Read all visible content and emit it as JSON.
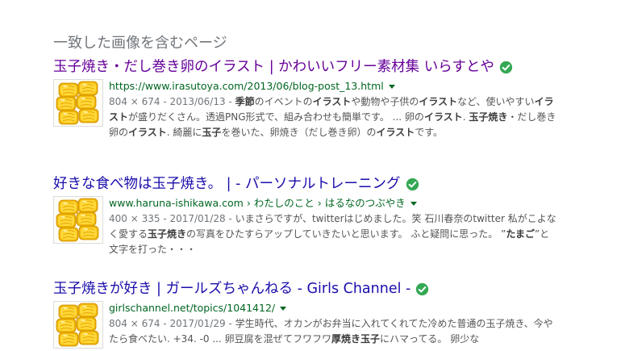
{
  "section_heading": "一致した画像を含むページ",
  "results": [
    {
      "title": "玉子焼き・だし巻き卵のイラスト | かわいいフリー素材集 いらすとや",
      "url": "https://www.irasutoya.com/2013/06/blog-post_13.html",
      "info": "804 × 674 - 2013/06/13 - ",
      "snippet": [
        {
          "t": "季節",
          "b": true
        },
        {
          "t": "のイベントの",
          "b": false
        },
        {
          "t": "イラスト",
          "b": true
        },
        {
          "t": "や動物や子供の",
          "b": false
        },
        {
          "t": "イラスト",
          "b": true
        },
        {
          "t": "など、使いやすい",
          "b": false
        },
        {
          "t": "イラスト",
          "b": true
        },
        {
          "t": "が盛りだくさん。透過PNG形式で、組み合わせも簡単です。 ... 卵の",
          "b": false
        },
        {
          "t": "イラスト",
          "b": true
        },
        {
          "t": ". ",
          "b": false
        },
        {
          "t": "玉子焼き",
          "b": true
        },
        {
          "t": "・だし巻き卵の",
          "b": false
        },
        {
          "t": "イラスト",
          "b": true
        },
        {
          "t": ". 綺麗に",
          "b": false
        },
        {
          "t": "玉子",
          "b": true
        },
        {
          "t": "を巻いた、卵焼き（だし巻き卵）の",
          "b": false
        },
        {
          "t": "イラスト",
          "b": true
        },
        {
          "t": "です。",
          "b": false
        }
      ],
      "visited": true
    },
    {
      "title": "好きな食べ物は玉子焼き。 | - パーソナルトレーニング",
      "url": "www.haruna-ishikawa.com › わたしのこと › はるなのつぶやき",
      "info": "400 × 335 - 2017/01/28 - ",
      "snippet": [
        {
          "t": "いまさらですが、twitterはじめました。笑 石川春奈のtwitter 私がこよなく愛する",
          "b": false
        },
        {
          "t": "玉子焼き",
          "b": true
        },
        {
          "t": "の写真をひたすらアップしていきたいと思います。 ふと疑問に思った。 ”",
          "b": false
        },
        {
          "t": "たまご",
          "b": true
        },
        {
          "t": "”と文字を打った・・・",
          "b": false
        }
      ],
      "visited": false
    },
    {
      "title": "玉子焼きが好き | ガールズちゃんねる - Girls Channel -",
      "url": "girlschannel.net/topics/1041412/",
      "info": "804 × 674 - 2017/01/29 - ",
      "snippet": [
        {
          "t": "学生時代、オカンがお弁当に入れてくれてた冷めた普通の玉子焼き、今やたら食べたい. +34. -0 ... 卵豆腐を混ぜてフワフワ",
          "b": false
        },
        {
          "t": "厚焼き玉子",
          "b": true
        },
        {
          "t": "にハマってる。 卵少な",
          "b": false
        }
      ],
      "visited": false
    }
  ],
  "colors": {
    "title_link": "#1a0dab",
    "title_visited": "#660099",
    "url_green": "#006621",
    "verified_green": "#34a853"
  },
  "icons": {
    "verified": "check-circle-icon",
    "dropdown": "caret-down-icon"
  }
}
